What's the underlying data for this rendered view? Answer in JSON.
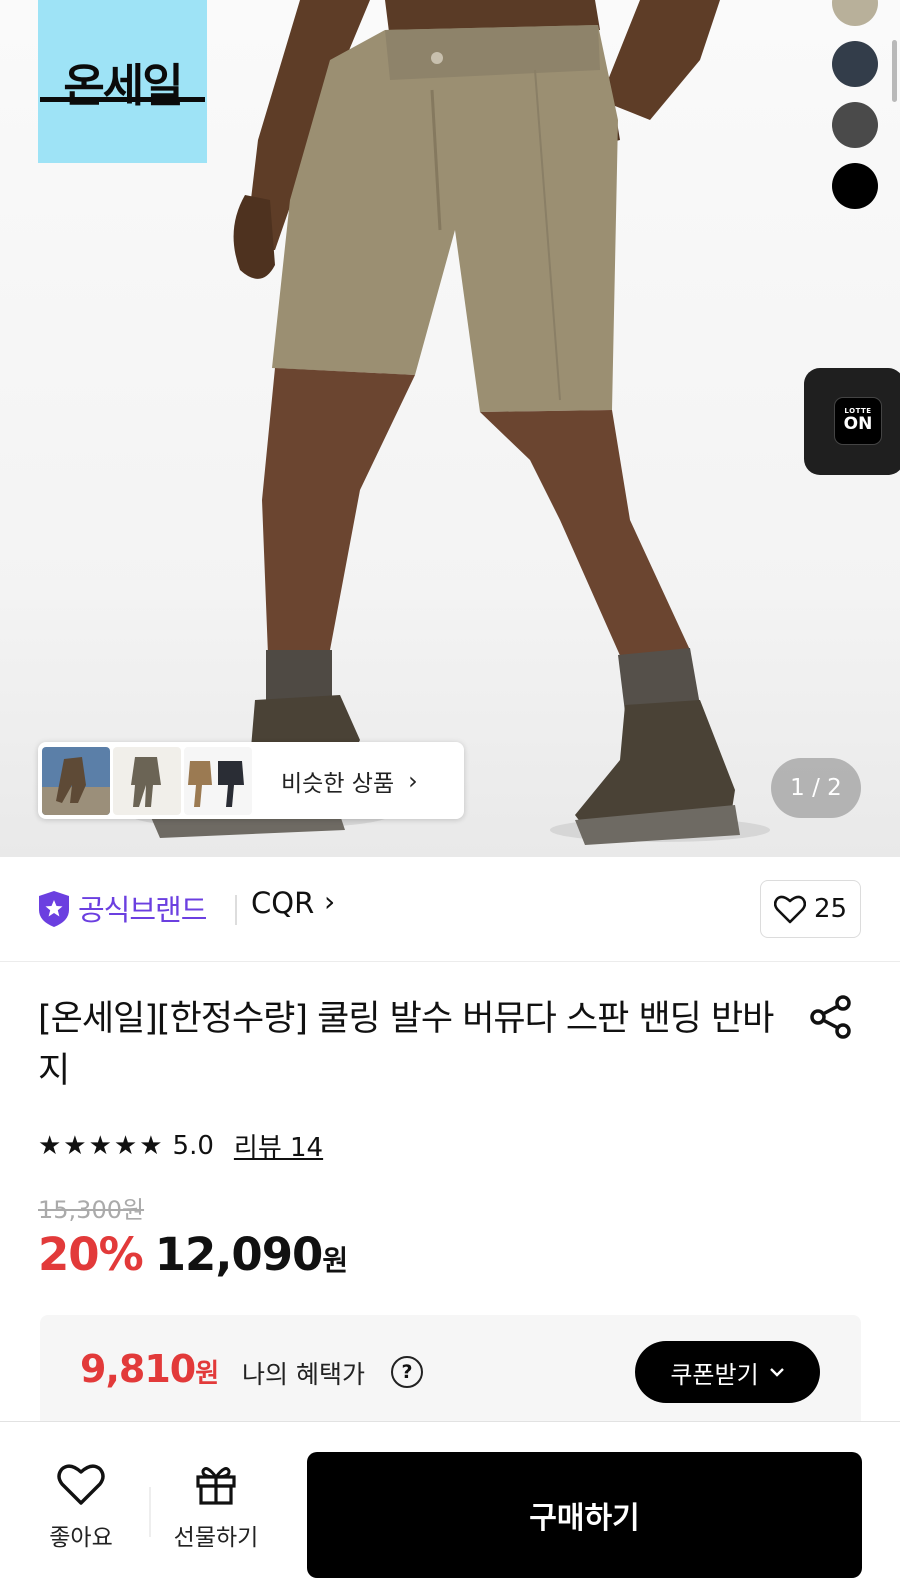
{
  "logo": {
    "text": "온세일"
  },
  "color_options": [
    "#b8b09a",
    "#333d4a",
    "#4a4a4a",
    "#000000"
  ],
  "lotte": {
    "line1": "LOTTE",
    "line2": "ON"
  },
  "similar": {
    "label": "비슷한 상품",
    "chevron": "›"
  },
  "pager": {
    "text": "1 / 2"
  },
  "brand": {
    "official_label": "공식브랜드",
    "name": "CQR",
    "chevron": "›",
    "like_count": "25"
  },
  "product": {
    "title": "[온세일][한정수량] 쿨링 발수 버뮤다 스판 밴딩 반바지"
  },
  "rating": {
    "stars": "★★★★★",
    "value": "5.0",
    "review_link": "리뷰 14"
  },
  "price": {
    "original": "15,300원",
    "discount": "20%",
    "amount": "12,090",
    "unit": "원"
  },
  "benefit": {
    "amount": "9,810",
    "unit": "원",
    "label": "나의 혜택가",
    "help": "?",
    "coupon_button": "쿠폰받기"
  },
  "bottom_nav": {
    "like_label": "좋아요",
    "gift_label": "선물하기",
    "buy_button": "구매하기"
  },
  "colors": {
    "accent_red": "#e23a3a",
    "brand_purple": "#6b3fe0",
    "logo_bg": "#9ee3f6"
  }
}
